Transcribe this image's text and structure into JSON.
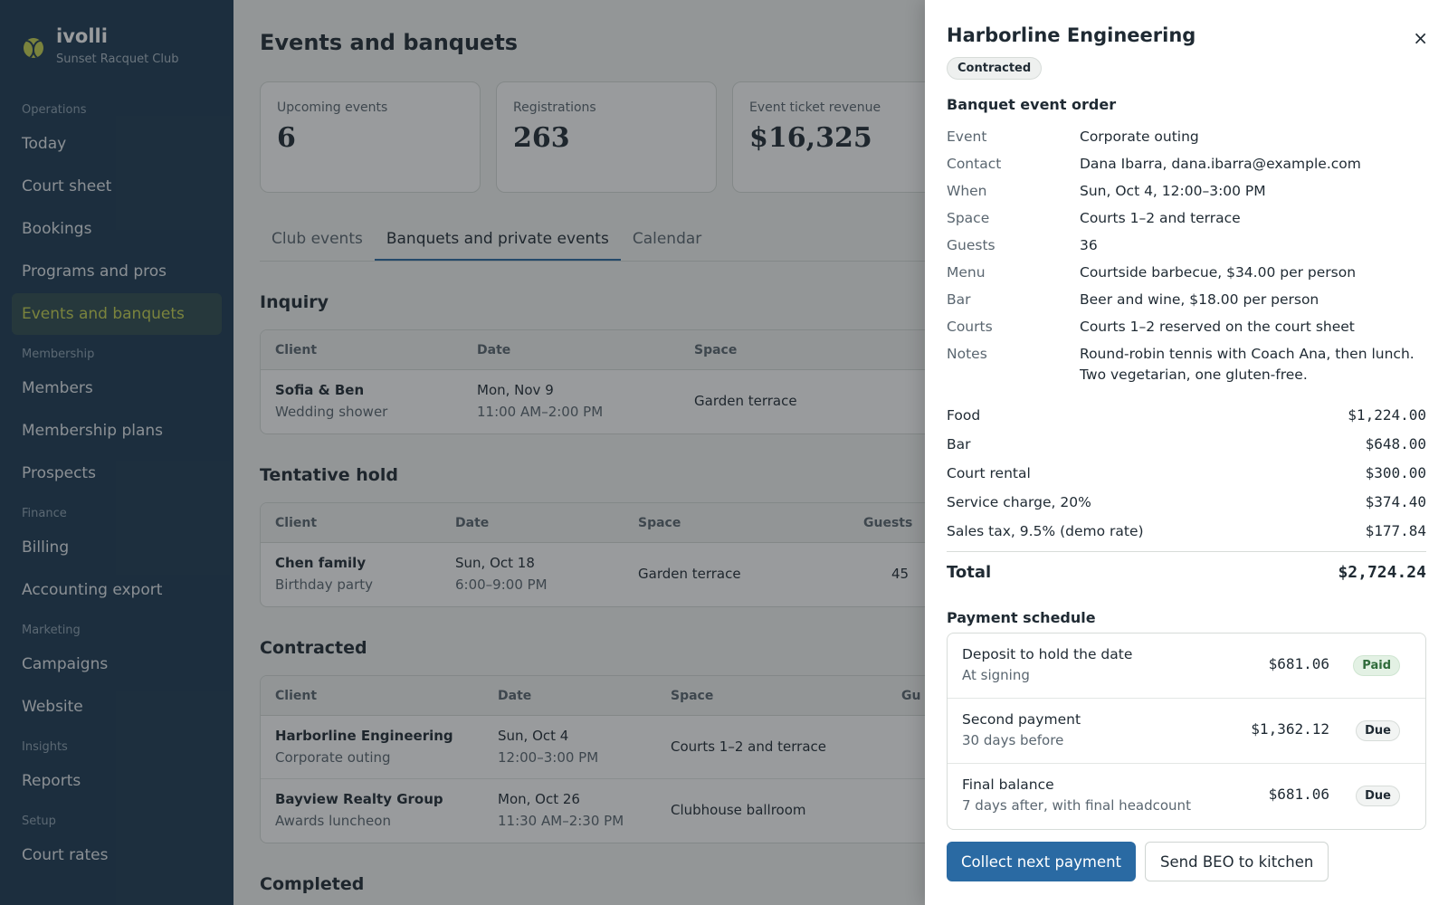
{
  "sidebar": {
    "brand_name": "ivolli",
    "brand_sub": "Sunset Racquet Club",
    "groups": {
      "operations": "Operations",
      "membership": "Membership",
      "finance": "Finance",
      "marketing": "Marketing",
      "insights": "Insights",
      "setup": "Setup"
    },
    "items": {
      "today": "Today",
      "court_sheet": "Court sheet",
      "bookings": "Bookings",
      "programs": "Programs and pros",
      "events": "Events and banquets",
      "members": "Members",
      "plans": "Membership plans",
      "prospects": "Prospects",
      "billing": "Billing",
      "accounting": "Accounting export",
      "campaigns": "Campaigns",
      "website": "Website",
      "reports": "Reports",
      "court_rates": "Court rates"
    }
  },
  "main": {
    "title": "Events and banquets",
    "stats": [
      {
        "label": "Upcoming events",
        "value": "6"
      },
      {
        "label": "Registrations",
        "value": "263"
      },
      {
        "label": "Event ticket revenue",
        "value": "$16,325"
      }
    ],
    "tabs": [
      "Club events",
      "Banquets and private events",
      "Calendar"
    ],
    "sections": {
      "inquiry": {
        "title": "Inquiry",
        "headers": [
          "Client",
          "Date",
          "Space"
        ],
        "rows": [
          {
            "client": "Sofia & Ben",
            "type": "Wedding shower",
            "date": "Mon, Nov 9",
            "time": "11:00 AM–2:00 PM",
            "space": "Garden terrace"
          }
        ]
      },
      "tentative": {
        "title": "Tentative hold",
        "headers": [
          "Client",
          "Date",
          "Space",
          "Guests"
        ],
        "rows": [
          {
            "client": "Chen family",
            "type": "Birthday party",
            "date": "Sun, Oct 18",
            "time": "6:00–9:00 PM",
            "space": "Garden terrace",
            "guests": "45"
          }
        ]
      },
      "contracted": {
        "title": "Contracted",
        "headers": [
          "Client",
          "Date",
          "Space",
          "Gu"
        ],
        "rows": [
          {
            "client": "Harborline Engineering",
            "type": "Corporate outing",
            "date": "Sun, Oct 4",
            "time": "12:00–3:00 PM",
            "space": "Courts 1–2 and terrace"
          },
          {
            "client": "Bayview Realty Group",
            "type": "Awards luncheon",
            "date": "Mon, Oct 26",
            "time": "11:30 AM–2:30 PM",
            "space": "Clubhouse ballroom"
          }
        ]
      },
      "completed": {
        "title": "Completed"
      }
    }
  },
  "drawer": {
    "title": "Harborline Engineering",
    "status": "Contracted",
    "close_glyph": "×",
    "beo_title": "Banquet event order",
    "details": [
      {
        "k": "Event",
        "v": "Corporate outing"
      },
      {
        "k": "Contact",
        "v": "Dana Ibarra, dana.ibarra@example.com"
      },
      {
        "k": "When",
        "v": "Sun, Oct 4, 12:00–3:00 PM"
      },
      {
        "k": "Space",
        "v": "Courts 1–2 and terrace"
      },
      {
        "k": "Guests",
        "v": "36"
      },
      {
        "k": "Menu",
        "v": "Courtside barbecue, $34.00 per person"
      },
      {
        "k": "Bar",
        "v": "Beer and wine, $18.00 per person"
      },
      {
        "k": "Courts",
        "v": "Courts 1–2 reserved on the court sheet"
      },
      {
        "k": "Notes",
        "v": "Round-robin tennis with Coach Ana, then lunch. Two vegetarian, one gluten-free."
      }
    ],
    "lines": [
      {
        "label": "Food",
        "amount": "$1,224.00"
      },
      {
        "label": "Bar",
        "amount": "$648.00"
      },
      {
        "label": "Court rental",
        "amount": "$300.00"
      },
      {
        "label": "Service charge, 20%",
        "amount": "$374.40"
      },
      {
        "label": "Sales tax, 9.5% (demo rate)",
        "amount": "$177.84"
      }
    ],
    "total_label": "Total",
    "total_amount": "$2,724.24",
    "payment_title": "Payment schedule",
    "payments": [
      {
        "name": "Deposit to hold the date",
        "when": "At signing",
        "amount": "$681.06",
        "status": "Paid"
      },
      {
        "name": "Second payment",
        "when": "30 days before",
        "amount": "$1,362.12",
        "status": "Due"
      },
      {
        "name": "Final balance",
        "when": "7 days after, with final headcount",
        "amount": "$681.06",
        "status": "Due"
      }
    ],
    "primary_action": "Collect next payment",
    "secondary_action": "Send BEO to kitchen"
  },
  "colors": {
    "sidebar_bg": "#1d3a52",
    "accent": "#c7d351",
    "primary": "#2a6aa3"
  },
  "icons": {
    "brand": "tennis-ball-icon",
    "close": "close-icon"
  }
}
